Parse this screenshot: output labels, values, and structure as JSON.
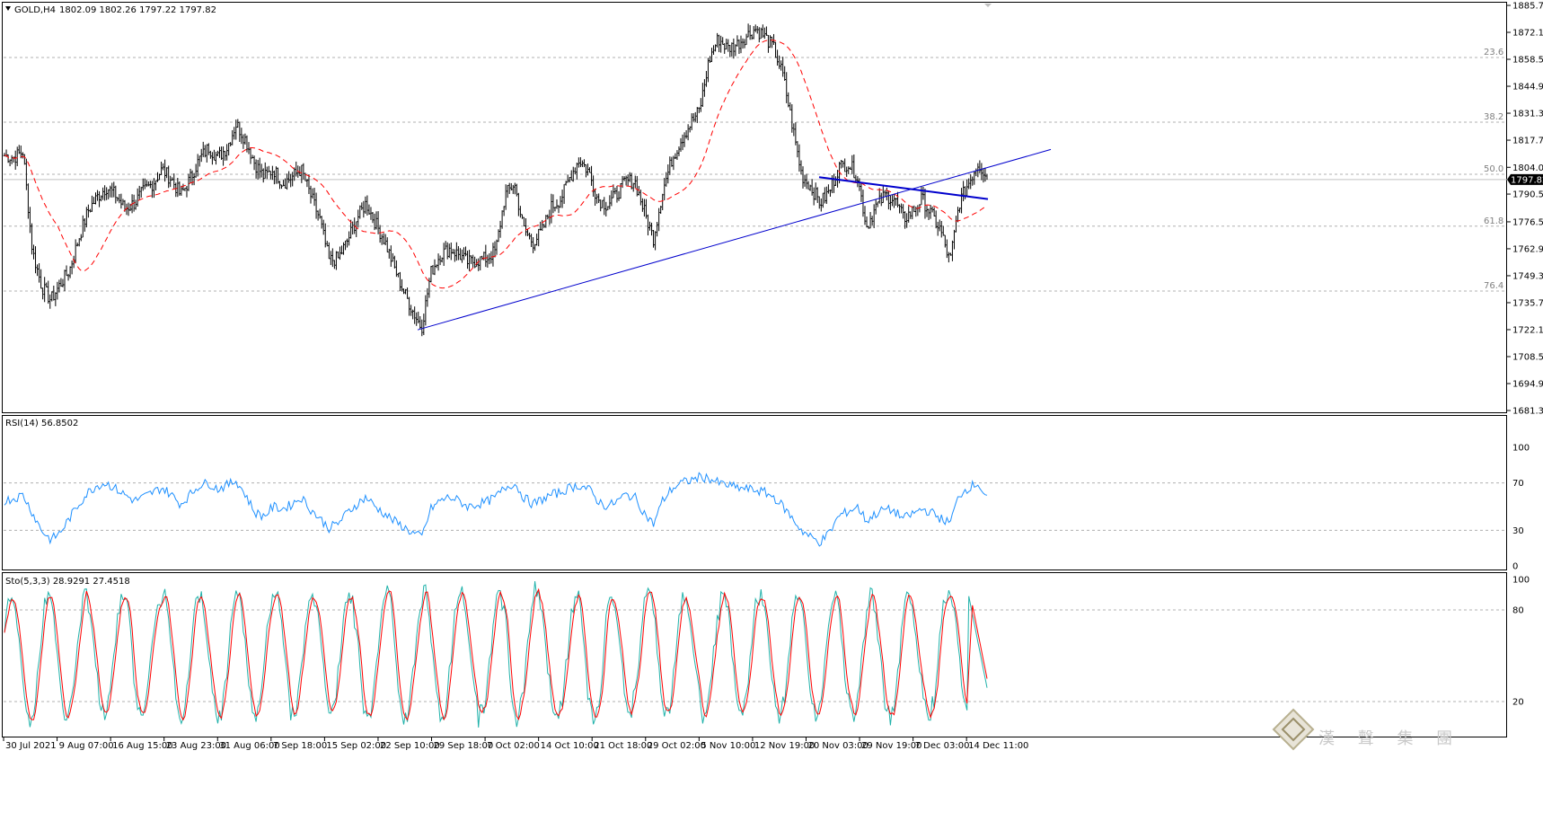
{
  "main_header": {
    "symbol": "GOLD,H4",
    "ohlc": "1802.09 1802.26 1797.22 1797.82"
  },
  "rsi_header": "RSI(14) 56.8502",
  "sto_header": "Sto(5,3,3) 28.9291 27.4518",
  "watermark": "漢 聲 集 團",
  "colors": {
    "candles": "#000000",
    "ma": "#ff0000",
    "trendlines": "#0000cd",
    "rsi": "#1e90ff",
    "sto_main": "#20b2aa",
    "sto_signal": "#ff0000",
    "grid": "#b0b0b0",
    "background": "#ffffff"
  },
  "chart_data": [
    {
      "type": "candlestick",
      "panel": "price",
      "title": "GOLD,H4",
      "timeframe": "H4",
      "last_price": "1797.82",
      "y_ticks": [
        "1885.70",
        "1872.10",
        "1858.50",
        "1844.90",
        "1831.30",
        "1817.70",
        "1804.00",
        "1790.50",
        "1776.50",
        "1762.90",
        "1749.30",
        "1735.70",
        "1722.10",
        "1708.50",
        "1694.90",
        "1681.30"
      ],
      "ylim": [
        1681.3,
        1885.7
      ],
      "x_ticks": [
        "30 Jul 2021",
        "9 Aug 07:00",
        "16 Aug 15:00",
        "23 Aug 23:00",
        "31 Aug 06:00",
        "7 Sep 18:00",
        "15 Sep 02:00",
        "22 Sep 10:00",
        "29 Sep 18:00",
        "7 Oct 02:00",
        "14 Oct 10:00",
        "21 Oct 18:00",
        "29 Oct 02:00",
        "5 Nov 10:00",
        "12 Nov 19:00",
        "20 Nov 03:00",
        "29 Nov 19:00",
        "7 Dec 03:00",
        "14 Dec 11:00"
      ],
      "fib_levels": [
        {
          "label": "23.6",
          "value": 1859.4
        },
        {
          "label": "38.2",
          "value": 1826.8
        },
        {
          "label": "50.0",
          "value": 1800.5
        },
        {
          "label": "61.8",
          "value": 1774.3
        },
        {
          "label": "76.4",
          "value": 1741.6
        }
      ],
      "price_anchors": [
        1810,
        1809,
        1812,
        1762,
        1744,
        1737,
        1745,
        1752,
        1768,
        1782,
        1789,
        1794,
        1790,
        1783,
        1786,
        1792,
        1796,
        1803,
        1798,
        1790,
        1798,
        1808,
        1814,
        1809,
        1814,
        1826,
        1818,
        1806,
        1799,
        1803,
        1796,
        1799,
        1803,
        1790,
        1778,
        1757,
        1758,
        1767,
        1778,
        1786,
        1776,
        1767,
        1754,
        1742,
        1732,
        1723,
        1751,
        1760,
        1763,
        1760,
        1756,
        1757,
        1758,
        1762,
        1790,
        1796,
        1773,
        1766,
        1772,
        1784,
        1788,
        1799,
        1808,
        1802,
        1788,
        1785,
        1790,
        1797,
        1797,
        1782,
        1768,
        1792,
        1808,
        1818,
        1826,
        1833,
        1858,
        1869,
        1864,
        1866,
        1870,
        1874,
        1870,
        1864,
        1850,
        1825,
        1800,
        1794,
        1786,
        1792,
        1804,
        1806,
        1800,
        1774,
        1784,
        1790,
        1788,
        1778,
        1782,
        1788,
        1780,
        1772,
        1756,
        1786,
        1796,
        1806,
        1800
      ],
      "moving_average": {
        "type": "dashed",
        "period": "unlabeled"
      },
      "trendlines": [
        {
          "from": {
            "x": "29 Sep 18:00",
            "y": 1722
          },
          "to": {
            "x": "extends right",
            "y": 1813
          }
        },
        {
          "from": {
            "x": "20 Nov 03:00",
            "y": 1799
          },
          "to": {
            "x": "14 Dec 11:00",
            "y": 1788
          }
        }
      ]
    },
    {
      "type": "line",
      "panel": "RSI(14)",
      "title": "RSI(14) 56.8502",
      "last_value": 56.8502,
      "ylim": [
        0,
        100
      ],
      "y_ticks": [
        "100",
        "70",
        "30",
        "0"
      ],
      "levels": [
        70,
        30
      ],
      "anchors": [
        55,
        57,
        60,
        45,
        30,
        22,
        28,
        40,
        52,
        62,
        68,
        70,
        65,
        60,
        55,
        58,
        62,
        66,
        60,
        52,
        60,
        68,
        70,
        65,
        68,
        72,
        60,
        45,
        42,
        50,
        48,
        52,
        58,
        48,
        40,
        32,
        36,
        45,
        52,
        58,
        50,
        44,
        38,
        33,
        28,
        24,
        48,
        55,
        58,
        55,
        50,
        52,
        54,
        58,
        66,
        70,
        58,
        52,
        56,
        60,
        62,
        66,
        68,
        65,
        55,
        50,
        54,
        60,
        58,
        45,
        35,
        55,
        65,
        70,
        72,
        75,
        74,
        70,
        68,
        66,
        65,
        64,
        62,
        58,
        50,
        40,
        30,
        24,
        20,
        28,
        42,
        46,
        50,
        38,
        44,
        48,
        46,
        40,
        44,
        48,
        45,
        40,
        36,
        60,
        66,
        70,
        56
      ]
    },
    {
      "type": "line",
      "panel": "Sto(5,3,3)",
      "title": "Sto(5,3,3) 28.9291 27.4518",
      "main_last": 28.9291,
      "signal_last": 27.4518,
      "ylim": [
        0,
        100
      ],
      "y_ticks": [
        "100",
        "80",
        "20"
      ],
      "levels": [
        80,
        20
      ]
    }
  ]
}
